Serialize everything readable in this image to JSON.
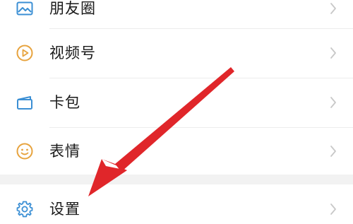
{
  "menu": {
    "items": [
      {
        "label": "朋友圈",
        "icon": "moments-icon"
      },
      {
        "label": "视频号",
        "icon": "channels-icon"
      },
      {
        "label": "卡包",
        "icon": "card-wallet-icon"
      },
      {
        "label": "表情",
        "icon": "stickers-icon"
      },
      {
        "label": "设置",
        "icon": "gear-icon"
      }
    ]
  },
  "colors": {
    "icon_blue": "#3b8fd4",
    "icon_orange": "#e7a33e",
    "chevron": "#c8c8c8",
    "arrow_red": "#e0262a",
    "section_gap": "#f2f2f2"
  }
}
